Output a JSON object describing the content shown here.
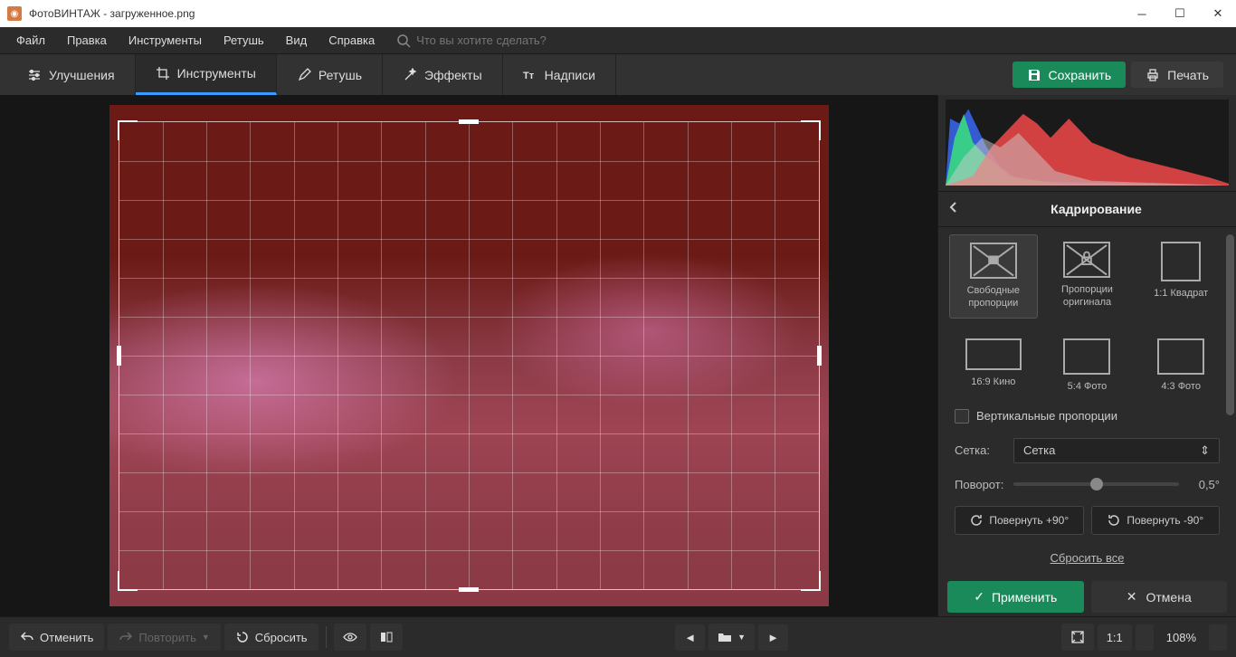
{
  "window": {
    "title": "ФотоВИНТАЖ - загруженное.png"
  },
  "menu": {
    "file": "Файл",
    "edit": "Правка",
    "tools": "Инструменты",
    "retouch": "Ретушь",
    "view": "Вид",
    "help": "Справка",
    "search_placeholder": "Что вы хотите сделать?"
  },
  "tabs": {
    "enhance": "Улучшения",
    "tools": "Инструменты",
    "retouch": "Ретушь",
    "effects": "Эффекты",
    "text": "Надписи"
  },
  "actions": {
    "save": "Сохранить",
    "print": "Печать"
  },
  "panel": {
    "title": "Кадрирование",
    "presets": {
      "free": "Свободные пропорции",
      "original": "Пропорции оригинала",
      "square": "1:1 Квадрат",
      "cinema": "16:9 Кино",
      "photo54": "5:4 Фото",
      "photo43": "4:3 Фото"
    },
    "vertical_checkbox": "Вертикальные пропорции",
    "grid_label": "Сетка:",
    "grid_value": "Сетка",
    "rotate_label": "Поворот:",
    "rotate_value": "0,5°",
    "rotate_cw": "Повернуть +90°",
    "rotate_ccw": "Повернуть -90°",
    "reset": "Сбросить все",
    "apply": "Применить",
    "cancel": "Отмена"
  },
  "bottom": {
    "undo": "Отменить",
    "redo": "Повторить",
    "reset": "Сбросить",
    "ratio11": "1:1",
    "zoom": "108%"
  }
}
